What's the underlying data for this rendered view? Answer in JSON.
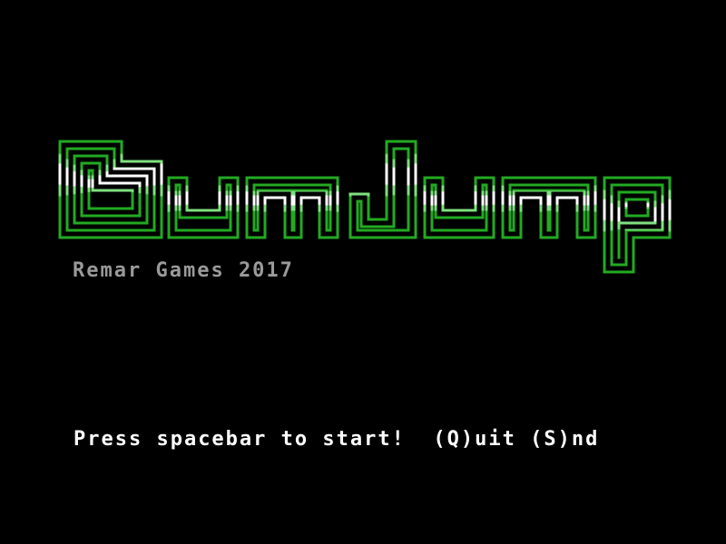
{
  "game": {
    "logo_text": "DumJump",
    "subtitle": "Remar Games 2017",
    "start_prompt": "Press spacebar to start!",
    "quit_option": "(Q)uit",
    "sound_option": "(S)nd"
  },
  "colors": {
    "background": "#000000",
    "logo_green": "#22aa22",
    "logo_light_green": "#7fe07f",
    "logo_white": "#ffffff",
    "subtitle_gray": "#9a9a9a",
    "prompt_white": "#ffffff"
  }
}
